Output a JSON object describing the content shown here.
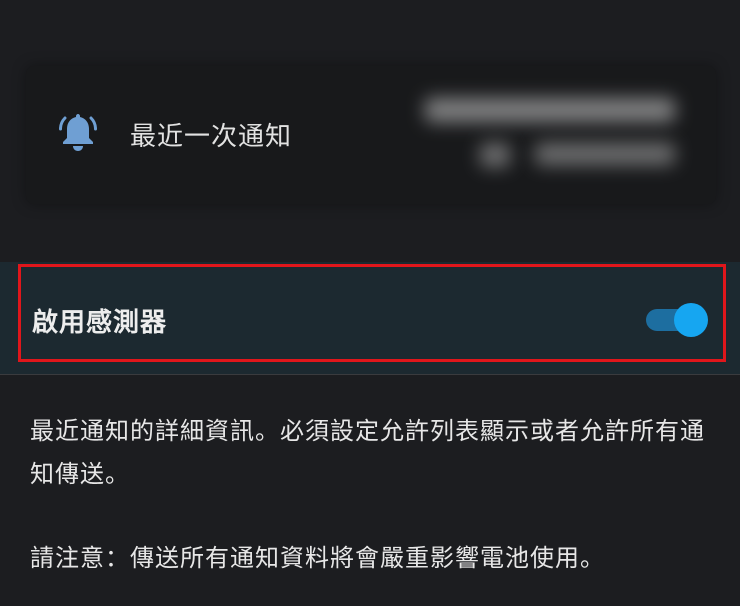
{
  "last_notification": {
    "label": "最近一次通知",
    "icon": "bell-icon",
    "icon_color": "#6f9fd3"
  },
  "sensor": {
    "label": "啟用感測器",
    "enabled": true,
    "accent_color": "#16a6f1"
  },
  "description": {
    "text": "最近通知的詳細資訊。必須設定允許列表顯示或者允許所有通知傳送。",
    "note": "請注意：傳送所有通知資料將會嚴重影響電池使用。"
  }
}
